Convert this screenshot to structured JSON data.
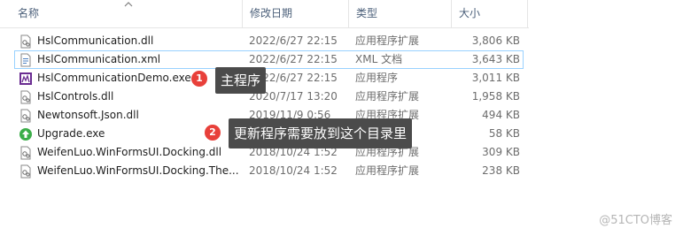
{
  "columns": {
    "name": "名称",
    "date": "修改日期",
    "type": "类型",
    "size": "大小"
  },
  "files": [
    {
      "name": "HslCommunication.dll",
      "date": "2022/6/27 22:15",
      "type": "应用程序扩展",
      "size": "3,806 KB",
      "icon": "dll-icon"
    },
    {
      "name": "HslCommunication.xml",
      "date": "2022/6/27 22:15",
      "type": "XML 文档",
      "size": "3,643 KB",
      "icon": "xml-icon"
    },
    {
      "name": "HslCommunicationDemo.exe",
      "date": "2022/6/27 22:15",
      "type": "应用程序",
      "size": "3,011 KB",
      "icon": "exe-app-icon"
    },
    {
      "name": "HslControls.dll",
      "date": "2020/7/17 13:20",
      "type": "应用程序扩展",
      "size": "1,958 KB",
      "icon": "dll-icon"
    },
    {
      "name": "Newtonsoft.Json.dll",
      "date": "2019/11/9 0:56",
      "type": "应用程序扩展",
      "size": "494 KB",
      "icon": "dll-icon"
    },
    {
      "name": "Upgrade.exe",
      "date": "",
      "type": "应用程序",
      "size": "58 KB",
      "icon": "upgrade-icon"
    },
    {
      "name": "WeifenLuo.WinFormsUI.Docking.dll",
      "date": "2018/10/24 1:52",
      "type": "应用程序扩展",
      "size": "309 KB",
      "icon": "dll-icon"
    },
    {
      "name": "WeifenLuo.WinFormsUI.Docking.The...",
      "date": "2018/10/24 1:52",
      "type": "应用程序扩展",
      "size": "238 KB",
      "icon": "dll-icon"
    }
  ],
  "annotations": [
    {
      "number": "1",
      "text": "主程序"
    },
    {
      "number": "2",
      "text": "更新程序需要放到这个目录里"
    }
  ],
  "watermark": "@51CTO博客",
  "colors": {
    "badge": "#e8403a",
    "callout_bg": "#4b4b4b",
    "selection_border": "#99d1ff",
    "header_text": "#4c607a"
  }
}
